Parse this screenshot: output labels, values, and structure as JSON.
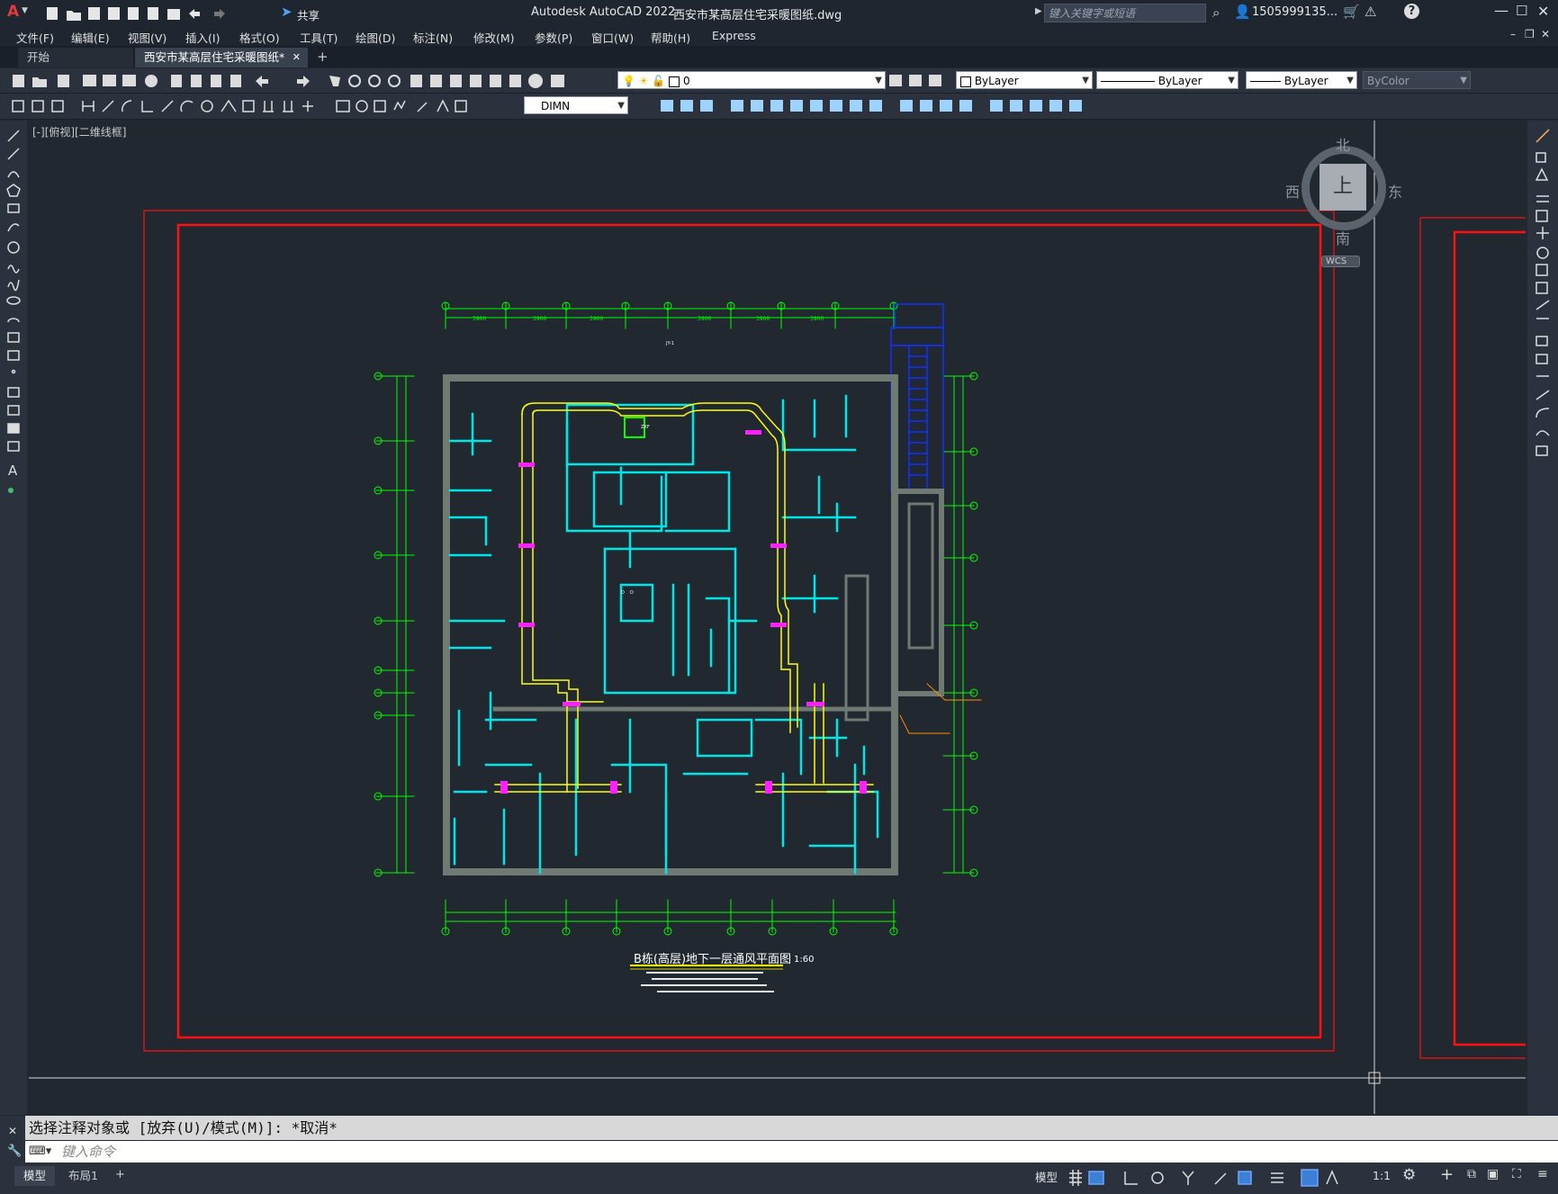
{
  "titlebar": {
    "app_title": "Autodesk AutoCAD 2022",
    "file_title": "西安市某高层住宅采暖图纸.dwg",
    "share_label": "共享",
    "search_placeholder": "键入关键字或短语",
    "user": "1505999135...",
    "app_menu_letter": "A"
  },
  "menu": {
    "items": [
      "文件(F)",
      "编辑(E)",
      "视图(V)",
      "插入(I)",
      "格式(O)",
      "工具(T)",
      "绘图(D)",
      "标注(N)",
      "修改(M)",
      "参数(P)",
      "窗口(W)",
      "帮助(H)",
      "Express"
    ]
  },
  "tabs": {
    "start": "开始",
    "active": "西安市某高层住宅采暖图纸*",
    "add": "+"
  },
  "toolbar": {
    "layer_value": "0",
    "color_value": "ByLayer",
    "linetype_value": "ByLayer",
    "lineweight_value": "ByLayer",
    "plotstyle_value": "ByColor",
    "dimstyle_value": "DIMN"
  },
  "viewport": {
    "label": "[-][俯视][二维线框]",
    "viewcube": {
      "north": "北",
      "south": "南",
      "east": "东",
      "west": "西",
      "face": "上",
      "wcs": "WCS"
    }
  },
  "drawing": {
    "title": "B栋(高层)地下一层通风平面图",
    "scale": "1:60",
    "colors": {
      "frame": "#ff0000",
      "dimension": "#00ff00",
      "wall": "#00e5e5",
      "duct": "#ffff00",
      "structure": "#6e7a72",
      "stair": "#0000ff"
    }
  },
  "command": {
    "history": "选择注释对象或 [放弃(U)/模式(M)]: *取消*",
    "placeholder": "键入命令"
  },
  "status": {
    "model_tab": "模型",
    "layout_tab": "布局1",
    "model_label": "模型",
    "scale": "1:1"
  }
}
